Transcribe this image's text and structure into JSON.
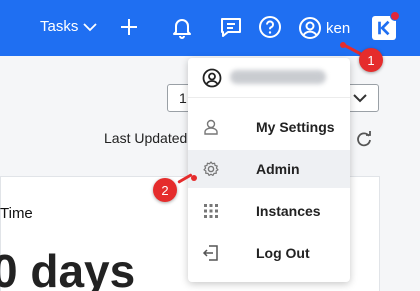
{
  "topbar": {
    "tasks_label": "Tasks",
    "username": "ken",
    "accent_color": "#1f6ff2",
    "icons": [
      "chevron-down-icon",
      "plus-icon",
      "bell-icon",
      "message-icon",
      "help-icon",
      "user-circle-icon",
      "k-logo-icon"
    ]
  },
  "background": {
    "select_value": "1",
    "last_updated_label": "Last Updated",
    "card_title": "Time",
    "card_value": "0 days"
  },
  "user_menu": {
    "email_hidden": true,
    "items": [
      {
        "label": "My Settings",
        "icon": "person-icon"
      },
      {
        "label": "Admin",
        "icon": "gear-icon"
      },
      {
        "label": "Instances",
        "icon": "grid-icon"
      },
      {
        "label": "Log Out",
        "icon": "logout-icon"
      }
    ]
  },
  "annotations": {
    "marker_1": "1",
    "marker_2": "2",
    "marker_color": "#e52c2c"
  }
}
